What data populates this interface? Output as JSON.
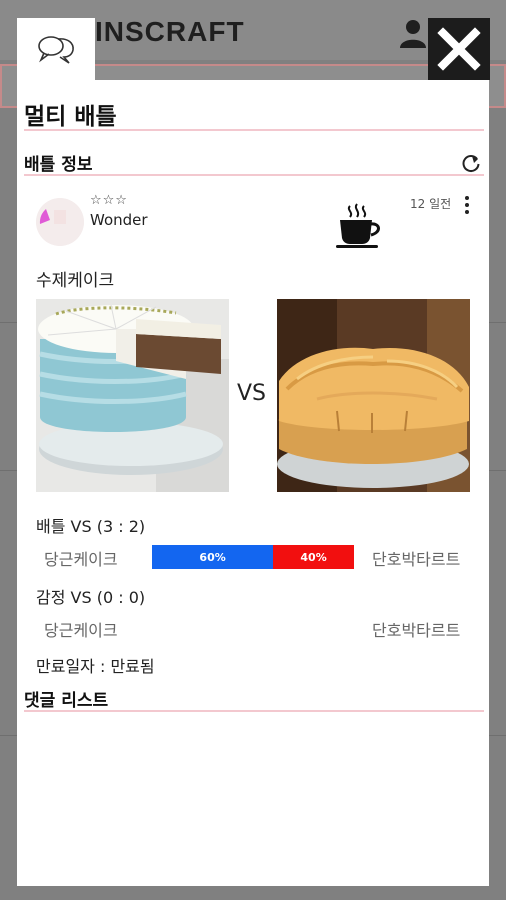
{
  "background": {
    "app_title": "INSCRAFT"
  },
  "modal": {
    "title": "멀티 배틀",
    "battle_info_label": "배틀 정보",
    "comment_list_label": "댓글 리스트"
  },
  "post": {
    "stars": "☆☆☆",
    "username": "Wonder",
    "time_ago": "12 일전",
    "title": "수제케이크",
    "vs_label": "VS",
    "images": [
      "carrot-cake-photo",
      "mont-blanc-tart-photo"
    ]
  },
  "battle": {
    "label": "배틀 VS",
    "score": "(3 : 2)",
    "left_option": "당근케이크",
    "right_option": "단호박타르트",
    "left_percent": 60,
    "right_percent": 40,
    "left_percent_label": "60%",
    "right_percent_label": "40%"
  },
  "emotion": {
    "label": "감정 VS",
    "score": "(0 : 0)",
    "left_option": "당근케이크",
    "right_option": "단호박타르트"
  },
  "expiry": {
    "label": "만료일자 : 만료됨"
  },
  "colors": {
    "accent_rule": "#f3c8cf",
    "bar_left": "#1366f0",
    "bar_right": "#f20f0f",
    "close_bg": "#1c1c1c"
  },
  "icons": [
    "chat-bubbles-icon",
    "close-icon",
    "refresh-icon",
    "coffee-cup-icon",
    "kebab-menu-icon",
    "user-icon"
  ]
}
